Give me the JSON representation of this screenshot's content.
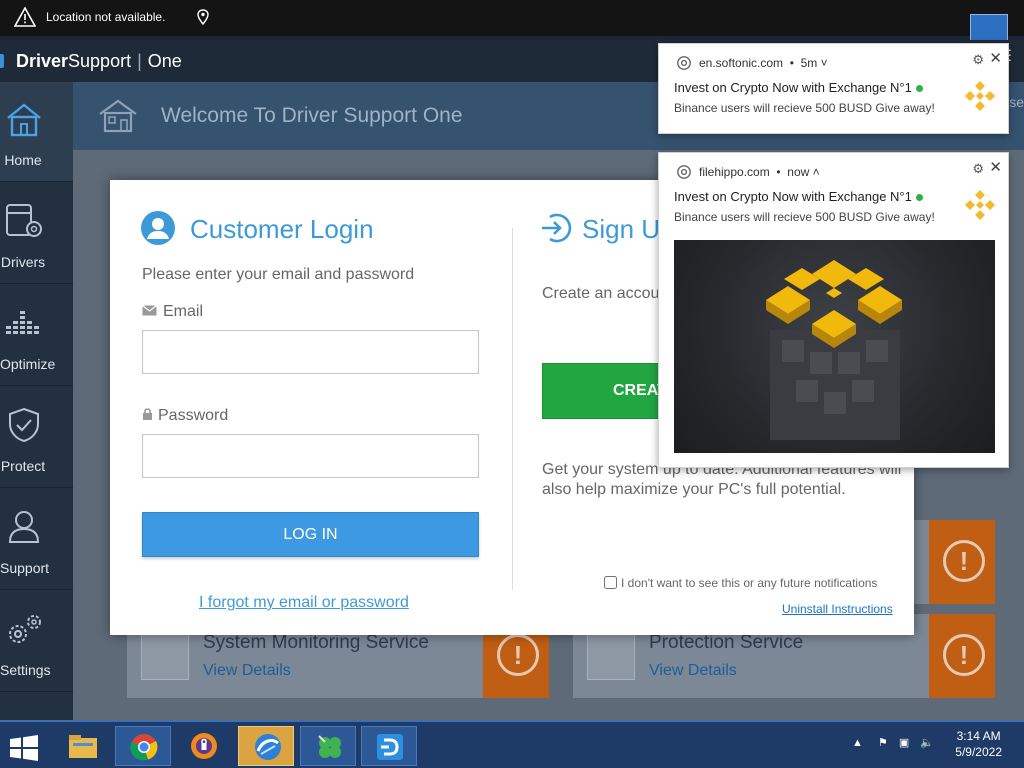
{
  "system_banner": {
    "message": "Location not available."
  },
  "app": {
    "brand_bold": "Driver",
    "brand_rest": "Support",
    "brand_suffix": "One",
    "menu_icon": "hamburger-icon"
  },
  "sidebar": {
    "items": [
      {
        "label": "Home",
        "icon": "house-icon",
        "active": true
      },
      {
        "label": "Drivers",
        "icon": "drivers-icon"
      },
      {
        "label": "Optimize",
        "icon": "bars-icon"
      },
      {
        "label": "Protect",
        "icon": "shield-icon"
      },
      {
        "label": "Support",
        "icon": "person-icon"
      },
      {
        "label": "Settings",
        "icon": "gears-icon"
      }
    ]
  },
  "welcome": {
    "title": "Welcome To Driver Support One",
    "right_fragment": "se"
  },
  "service_cards": [
    {
      "name": "System Monitoring Service",
      "link": "View Details"
    },
    {
      "name": "Protection Service",
      "link": "View Details"
    }
  ],
  "login": {
    "title": "Customer Login",
    "subtitle": "Please enter your email and password",
    "email_label": "Email",
    "email_value": "",
    "password_label": "Password",
    "password_value": "",
    "login_button": "LOG IN",
    "forgot_link": "I forgot my email or password"
  },
  "signup": {
    "title": "Sign Up",
    "create_desc": "Create an account to access our services.",
    "create_button": "CREATE ACCOUNT",
    "get_desc": "Get your system up to date. Additional features will also help maximize your PC's full potential."
  },
  "notifications_footer": {
    "optout_label": "I don't want to see this or any future notifications",
    "uninstall_link": "Uninstall Instructions"
  },
  "notifications": [
    {
      "source": "en.softonic.com",
      "time": "5m",
      "expander": "˅",
      "headline": "Invest on Crypto Now with Exchange N°1",
      "body": "Binance users will recieve 500 BUSD Give away!"
    },
    {
      "source": "filehippo.com",
      "time": "now",
      "expander": "˄",
      "headline": "Invest on Crypto Now with Exchange N°1",
      "body": "Binance users will recieve 500 BUSD Give away!"
    }
  ],
  "taskbar": {
    "time": "3:14 AM",
    "date": "5/9/2022",
    "apps": [
      "file-explorer-icon",
      "chrome-icon",
      "avast-browser-icon",
      "remote-app-icon",
      "clover-icon",
      "driver-support-icon"
    ]
  },
  "colors": {
    "accent_blue": "#3d9ad8",
    "create_green": "#21a642",
    "binance_yellow": "#f3ba2f",
    "alert_orange": "#c05e14"
  }
}
